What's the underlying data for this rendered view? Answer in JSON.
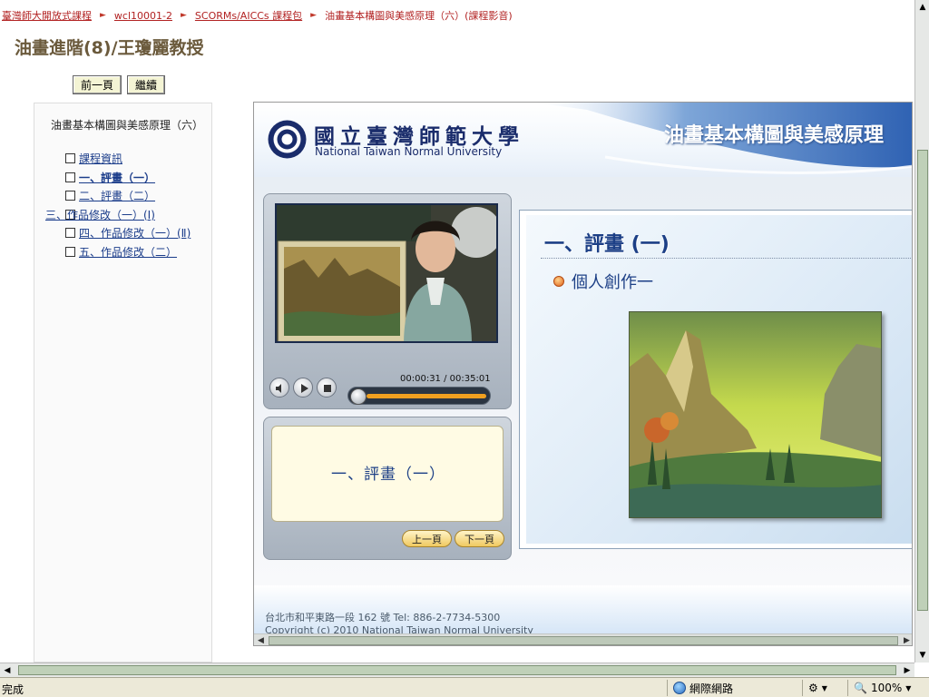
{
  "breadcrumb": {
    "items": [
      "臺灣師大開放式課程",
      "wcl10001-2",
      "SCORMs/AICCs 課程包"
    ],
    "current": "油畫基本構圖與美感原理（六）(課程影音)"
  },
  "page_title": "油畫進階(8)/王瓊麗教授",
  "nav": {
    "prev": "前一頁",
    "next": "繼續"
  },
  "toc": {
    "root": "油畫基本構圖與美感原理（六）",
    "items": [
      {
        "label": "課程資訊",
        "active": false
      },
      {
        "label": "一、評畫（一）",
        "active": true
      },
      {
        "label": "二、評畫（二）",
        "active": false
      },
      {
        "label": "三、作品修改（一）(Ⅰ)",
        "active": false
      },
      {
        "label": "四、作品修改（一）(Ⅱ)",
        "active": false
      },
      {
        "label": "五、作品修改（二）",
        "active": false
      }
    ]
  },
  "banner": {
    "university_zh": "國立臺灣師範大學",
    "university_en": "National Taiwan Normal University",
    "course_title": "油畫基本構圖與美感原理"
  },
  "player": {
    "time": "00:00:31 / 00:35:01",
    "progress": 0.015,
    "subtitle": "一、評畫（一）",
    "prev_label": "上一頁",
    "next_label": "下一頁"
  },
  "slide": {
    "heading": "一、評畫 (一)",
    "bullet": "個人創作一"
  },
  "footer": {
    "address": "台北市和平東路一段 162 號 Tel: 886-2-7734-5300",
    "copyright": "Copyright (c) 2010 National Taiwan Normal University"
  },
  "status": {
    "text": "完成",
    "zone": "網際網路",
    "zoom": "100%"
  },
  "colors": {
    "link": "#1a3c8a",
    "breadcrumb": "#b22222",
    "title": "#6b5a3c",
    "accent": "#f0a020"
  }
}
